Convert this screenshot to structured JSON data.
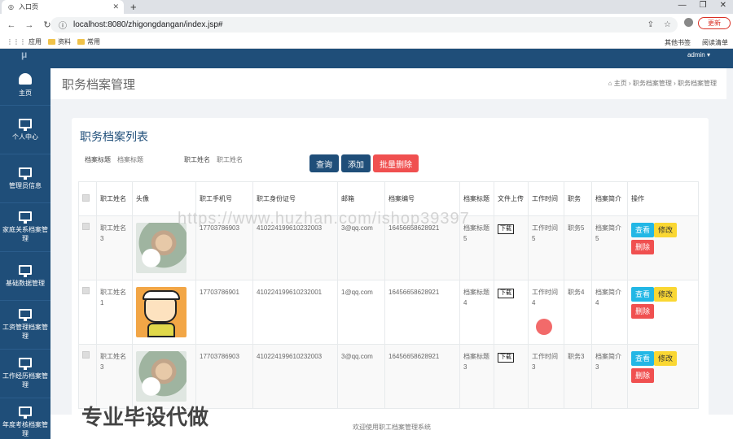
{
  "browser": {
    "tab_title": "入口页",
    "url": "localhost:8080/zhigongdangan/index.jsp#",
    "update_label": "更新",
    "bookmarks": [
      "应用",
      "资料",
      "常用"
    ],
    "bookmarks_right": [
      "其他书签",
      "阅读清单"
    ]
  },
  "app": {
    "admin": "admin ▾",
    "page_title": "职务档案管理",
    "breadcrumbs": [
      "主页",
      "职务档案管理",
      "职务档案管理"
    ],
    "card_title": "职务档案列表",
    "footer": "欢迎使用职工档案管理系统"
  },
  "sidebar": {
    "logo": "μ",
    "items": [
      {
        "label": "主页",
        "icon": "dashboard-icon"
      },
      {
        "label": "个人中心",
        "icon": "monitor-icon"
      },
      {
        "label": "管理员信息",
        "icon": "monitor-icon"
      },
      {
        "label": "家庭关系档案管理",
        "icon": "monitor-icon"
      },
      {
        "label": "基础数据管理",
        "icon": "monitor-icon"
      },
      {
        "label": "工资管理档案管理",
        "icon": "monitor-icon"
      },
      {
        "label": "工作经历档案管理",
        "icon": "monitor-icon"
      },
      {
        "label": "年度考核档案管理",
        "icon": "monitor-icon"
      }
    ]
  },
  "search": {
    "label1": "档案标题",
    "placeholder1": "档案标题",
    "label2": "职工姓名",
    "placeholder2": "职工姓名",
    "query": "查询",
    "add": "添加",
    "batch_delete": "批量删除"
  },
  "table": {
    "headers": [
      "职工姓名",
      "头像",
      "职工手机号",
      "职工身份证号",
      "邮箱",
      "档案编号",
      "档案标题",
      "文件上传",
      "工作时间",
      "职务",
      "档案简介",
      "操作"
    ],
    "rows": [
      {
        "name": "职工姓名3",
        "phone": "17703786903",
        "idcard": "410224199610232003",
        "email": "3@qq.com",
        "code": "16456658628921",
        "title": "档案标题5",
        "file": "下载",
        "time": "工作时间5",
        "duty": "职务5",
        "intro": "档案简介5"
      },
      {
        "name": "职工姓名1",
        "phone": "17703786901",
        "idcard": "410224199610232001",
        "email": "1@qq.com",
        "code": "16456658628921",
        "title": "档案标题4",
        "file": "下载",
        "time": "工作时间4",
        "duty": "职务4",
        "intro": "档案简介4"
      },
      {
        "name": "职工姓名3",
        "phone": "17703786903",
        "idcard": "410224199610232003",
        "email": "3@qq.com",
        "code": "16456658628921",
        "title": "档案标题3",
        "file": "下载",
        "time": "工作时间3",
        "duty": "职务3",
        "intro": "档案简介3"
      }
    ],
    "actions": {
      "view": "查看",
      "edit": "修改",
      "delete": "删除"
    }
  },
  "overlay": {
    "watermark": "https://www.huzhan.com/ishop39397",
    "promo": "专业毕设代做"
  }
}
